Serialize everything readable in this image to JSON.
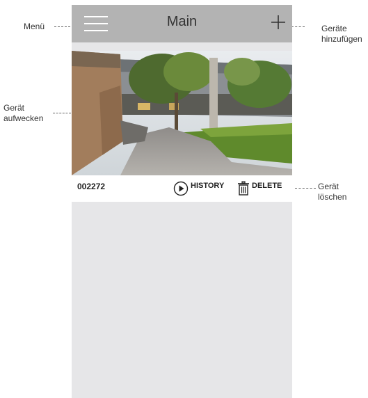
{
  "app": {
    "title": "Main"
  },
  "header": {
    "menu_icon": "hamburger-menu-icon",
    "add_icon": "plus-icon"
  },
  "device": {
    "id": "002272",
    "history_label": "HISTORY",
    "history_icon": "play-circle-icon",
    "delete_label": "DELETE",
    "delete_icon": "trash-icon"
  },
  "callouts": {
    "menu": "Menü",
    "add_devices": "Geräte\nhinzufügen",
    "wake_device": "Gerät\naufwecken",
    "delete_device": "Gerät\nlöschen"
  },
  "colors": {
    "header_bg": "#b3b3b3",
    "list_bg": "#e6e6e8",
    "card_bg": "#ffffff"
  }
}
